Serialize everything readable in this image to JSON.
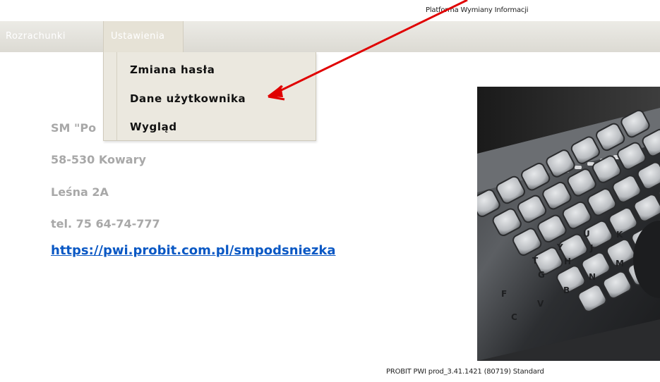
{
  "header": {
    "platform_title": "Platforma Wymiany Informacji"
  },
  "nav": {
    "items": [
      {
        "label": "Rozrachunki"
      },
      {
        "label": "Ustawienia"
      }
    ]
  },
  "dropdown": {
    "items": [
      {
        "label": "Zmiana hasła"
      },
      {
        "label": "Dane użytkownika"
      },
      {
        "label": "Wygląd"
      }
    ]
  },
  "contact": {
    "name": "SM \"Po",
    "postal": "58-530 Kowary",
    "street": "Leśna 2A",
    "phone": "tel. 75 64-74-777",
    "url": "https://pwi.probit.com.pl/smpodsniezka"
  },
  "footer": {
    "version": "PROBIT PWI prod_3.41.1421 (80719) Standard"
  },
  "colors": {
    "annotation_arrow": "#e00000",
    "link": "#0a58c4",
    "muted_text": "#a8a8a8",
    "nav_bg": "#e3e0d8"
  }
}
